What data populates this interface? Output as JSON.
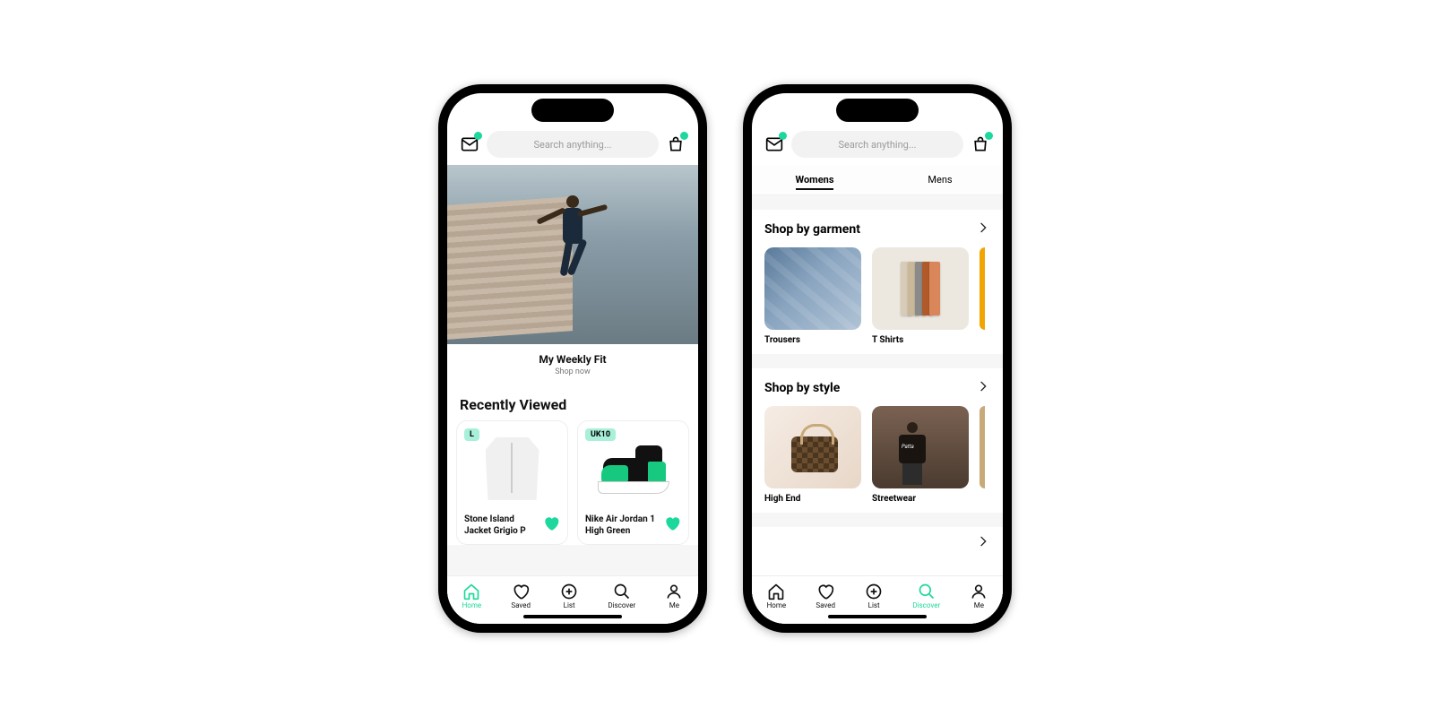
{
  "accent": "#1dd89c",
  "search_placeholder": "Search anything...",
  "phone1": {
    "hero": {
      "title": "My Weekly Fit",
      "subtitle": "Shop now"
    },
    "recently_viewed_title": "Recently Viewed",
    "products": [
      {
        "size": "L",
        "name": "Stone Island Jacket Grigio P"
      },
      {
        "size": "UK10",
        "name": "Nike Air Jordan 1 High Green"
      }
    ]
  },
  "phone2": {
    "tabs": [
      {
        "label": "Womens",
        "active": true
      },
      {
        "label": "Mens",
        "active": false
      }
    ],
    "sections": [
      {
        "title": "Shop by garment",
        "tiles": [
          "Trousers",
          "T Shirts"
        ]
      },
      {
        "title": "Shop by style",
        "tiles": [
          "High End",
          "Streetwear"
        ]
      }
    ]
  },
  "nav": [
    {
      "label": "Home",
      "icon": "home"
    },
    {
      "label": "Saved",
      "icon": "heart"
    },
    {
      "label": "List",
      "icon": "plus-circle"
    },
    {
      "label": "Discover",
      "icon": "search"
    },
    {
      "label": "Me",
      "icon": "user"
    }
  ],
  "phone1_active_nav": 0,
  "phone2_active_nav": 3
}
